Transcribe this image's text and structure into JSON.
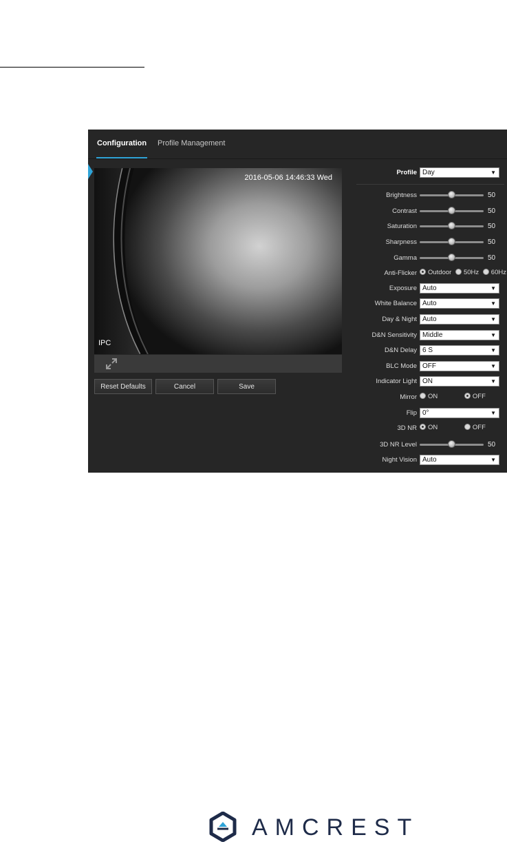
{
  "tabs": [
    {
      "label": "Configuration",
      "active": true
    },
    {
      "label": "Profile Management",
      "active": false
    }
  ],
  "video": {
    "timestamp": "2016-05-06 14:46:33 Wed",
    "channel_name": "IPC"
  },
  "buttons": {
    "reset": "Reset Defaults",
    "cancel": "Cancel",
    "save": "Save"
  },
  "settings": {
    "profile": {
      "label": "Profile",
      "value": "Day"
    },
    "brightness": {
      "label": "Brightness",
      "value": 50,
      "display": "50"
    },
    "contrast": {
      "label": "Contrast",
      "value": 50,
      "display": "50"
    },
    "saturation": {
      "label": "Saturation",
      "value": 50,
      "display": "50"
    },
    "sharpness": {
      "label": "Sharpness",
      "value": 50,
      "display": "50"
    },
    "gamma": {
      "label": "Gamma",
      "value": 50,
      "display": "50"
    },
    "anti_flicker": {
      "label": "Anti-Flicker",
      "options": [
        "Outdoor",
        "50Hz",
        "60Hz"
      ],
      "selected": "Outdoor"
    },
    "exposure": {
      "label": "Exposure",
      "value": "Auto"
    },
    "white_balance": {
      "label": "White Balance",
      "value": "Auto"
    },
    "day_night": {
      "label": "Day & Night",
      "value": "Auto"
    },
    "dn_sensitivity": {
      "label": "D&N Sensitivity",
      "value": "Middle"
    },
    "dn_delay": {
      "label": "D&N Delay",
      "value": "6 S"
    },
    "blc_mode": {
      "label": "BLC Mode",
      "value": "OFF"
    },
    "indicator_light": {
      "label": "Indicator Light",
      "value": "ON"
    },
    "mirror": {
      "label": "Mirror",
      "options": [
        "ON",
        "OFF"
      ],
      "selected": "OFF"
    },
    "flip": {
      "label": "Flip",
      "value": "0°"
    },
    "nr3d": {
      "label": "3D NR",
      "options": [
        "ON",
        "OFF"
      ],
      "selected": "ON"
    },
    "nr3d_level": {
      "label": "3D NR Level",
      "value": 50,
      "display": "50"
    },
    "night_vision": {
      "label": "Night Vision",
      "value": "Auto"
    }
  },
  "branding": {
    "name": "AMCREST"
  },
  "colors": {
    "accent": "#2fa4d8",
    "panel": "#262626",
    "brand": "#1e2b49"
  },
  "icons": {
    "fullscreen": "expand-arrows-icon",
    "logo": "amcrest-hexagon-logo-icon",
    "dropdown": "caret-down-icon"
  }
}
